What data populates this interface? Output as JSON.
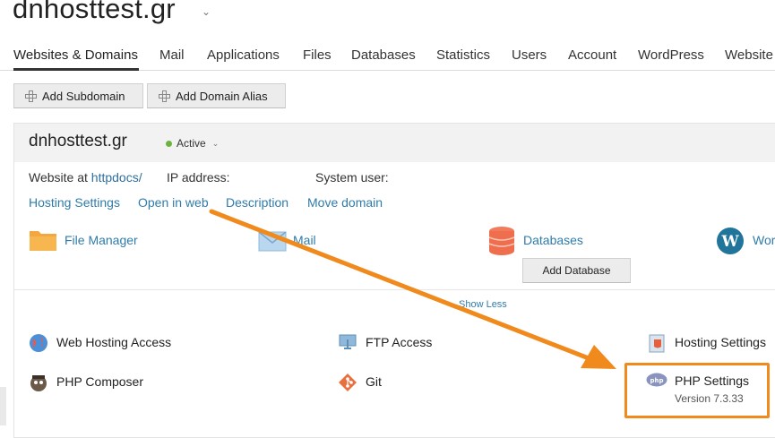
{
  "header": {
    "title": "dnhosttest.gr",
    "title_caret": "⌄"
  },
  "tabs": [
    {
      "label": "Websites & Domains"
    },
    {
      "label": "Mail"
    },
    {
      "label": "Applications"
    },
    {
      "label": "Files"
    },
    {
      "label": "Databases"
    },
    {
      "label": "Statistics"
    },
    {
      "label": "Users"
    },
    {
      "label": "Account"
    },
    {
      "label": "WordPress"
    },
    {
      "label": "Website"
    }
  ],
  "toolbar": {
    "add_subdomain": "Add Subdomain",
    "add_domain_alias": "Add Domain Alias"
  },
  "domain": {
    "name": "dnhosttest.gr",
    "status": "Active",
    "website_at_label": "Website at",
    "website_at_value": "httpdocs/",
    "ip_label": "IP address:",
    "system_user_label": "System user:",
    "links": [
      "Hosting Settings",
      "Open in web",
      "Description",
      "Move domain"
    ]
  },
  "apps": {
    "file_manager": "File Manager",
    "mail": "Mail",
    "databases": "Databases",
    "add_database": "Add Database",
    "wordpress": "Wor"
  },
  "show_less": "Show Less",
  "tools": {
    "web_hosting_access": "Web Hosting Access",
    "ftp_access": "FTP Access",
    "hosting_settings": "Hosting Settings",
    "php_composer": "PHP Composer",
    "git": "Git",
    "php_settings": "PHP Settings",
    "php_version": "Version 7.3.33"
  },
  "colors": {
    "accent": "#f08a1c",
    "link": "#2f7cab",
    "active": "#6cb33f"
  }
}
